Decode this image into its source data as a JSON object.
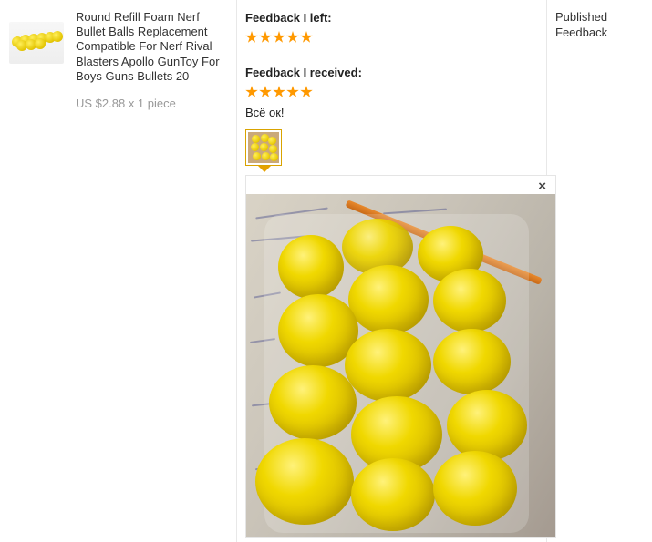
{
  "product": {
    "title": "Round Refill Foam Nerf Bullet Balls Replacement Compatible For Nerf Rival Blasters Apollo GunToy For Boys Guns Bullets 20",
    "price": "US $2.88 x 1 piece",
    "thumbnail_icon": "yellow-balls-thumbnail"
  },
  "feedback": {
    "left_label": "Feedback I left:",
    "left_rating": 5,
    "received_label": "Feedback I received:",
    "received_rating": 5,
    "received_comment": "Всё ок!",
    "close_symbol": "×"
  },
  "status": {
    "label": "Published Feedback"
  },
  "colors": {
    "star": "#ff9900",
    "accent_border": "#d9a300"
  }
}
